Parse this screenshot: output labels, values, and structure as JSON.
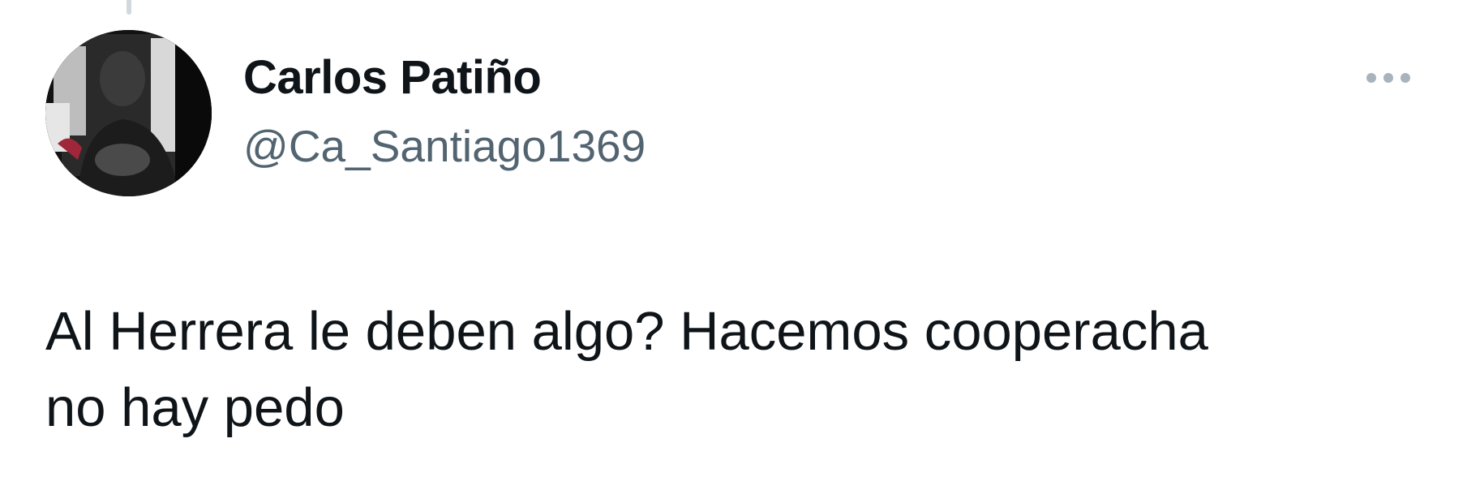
{
  "tweet": {
    "author": {
      "display_name": "Carlos Patiño",
      "handle": "@Ca_Santiago1369"
    },
    "text": "Al Herrera le deben algo? Hacemos cooperacha\nno hay pedo"
  },
  "colors": {
    "text_primary": "#0f1419",
    "text_secondary": "#536471",
    "icon_muted": "#a8b3bc",
    "thread_line": "#cfd9de"
  },
  "icons": {
    "more": "more-horizontal-icon"
  }
}
